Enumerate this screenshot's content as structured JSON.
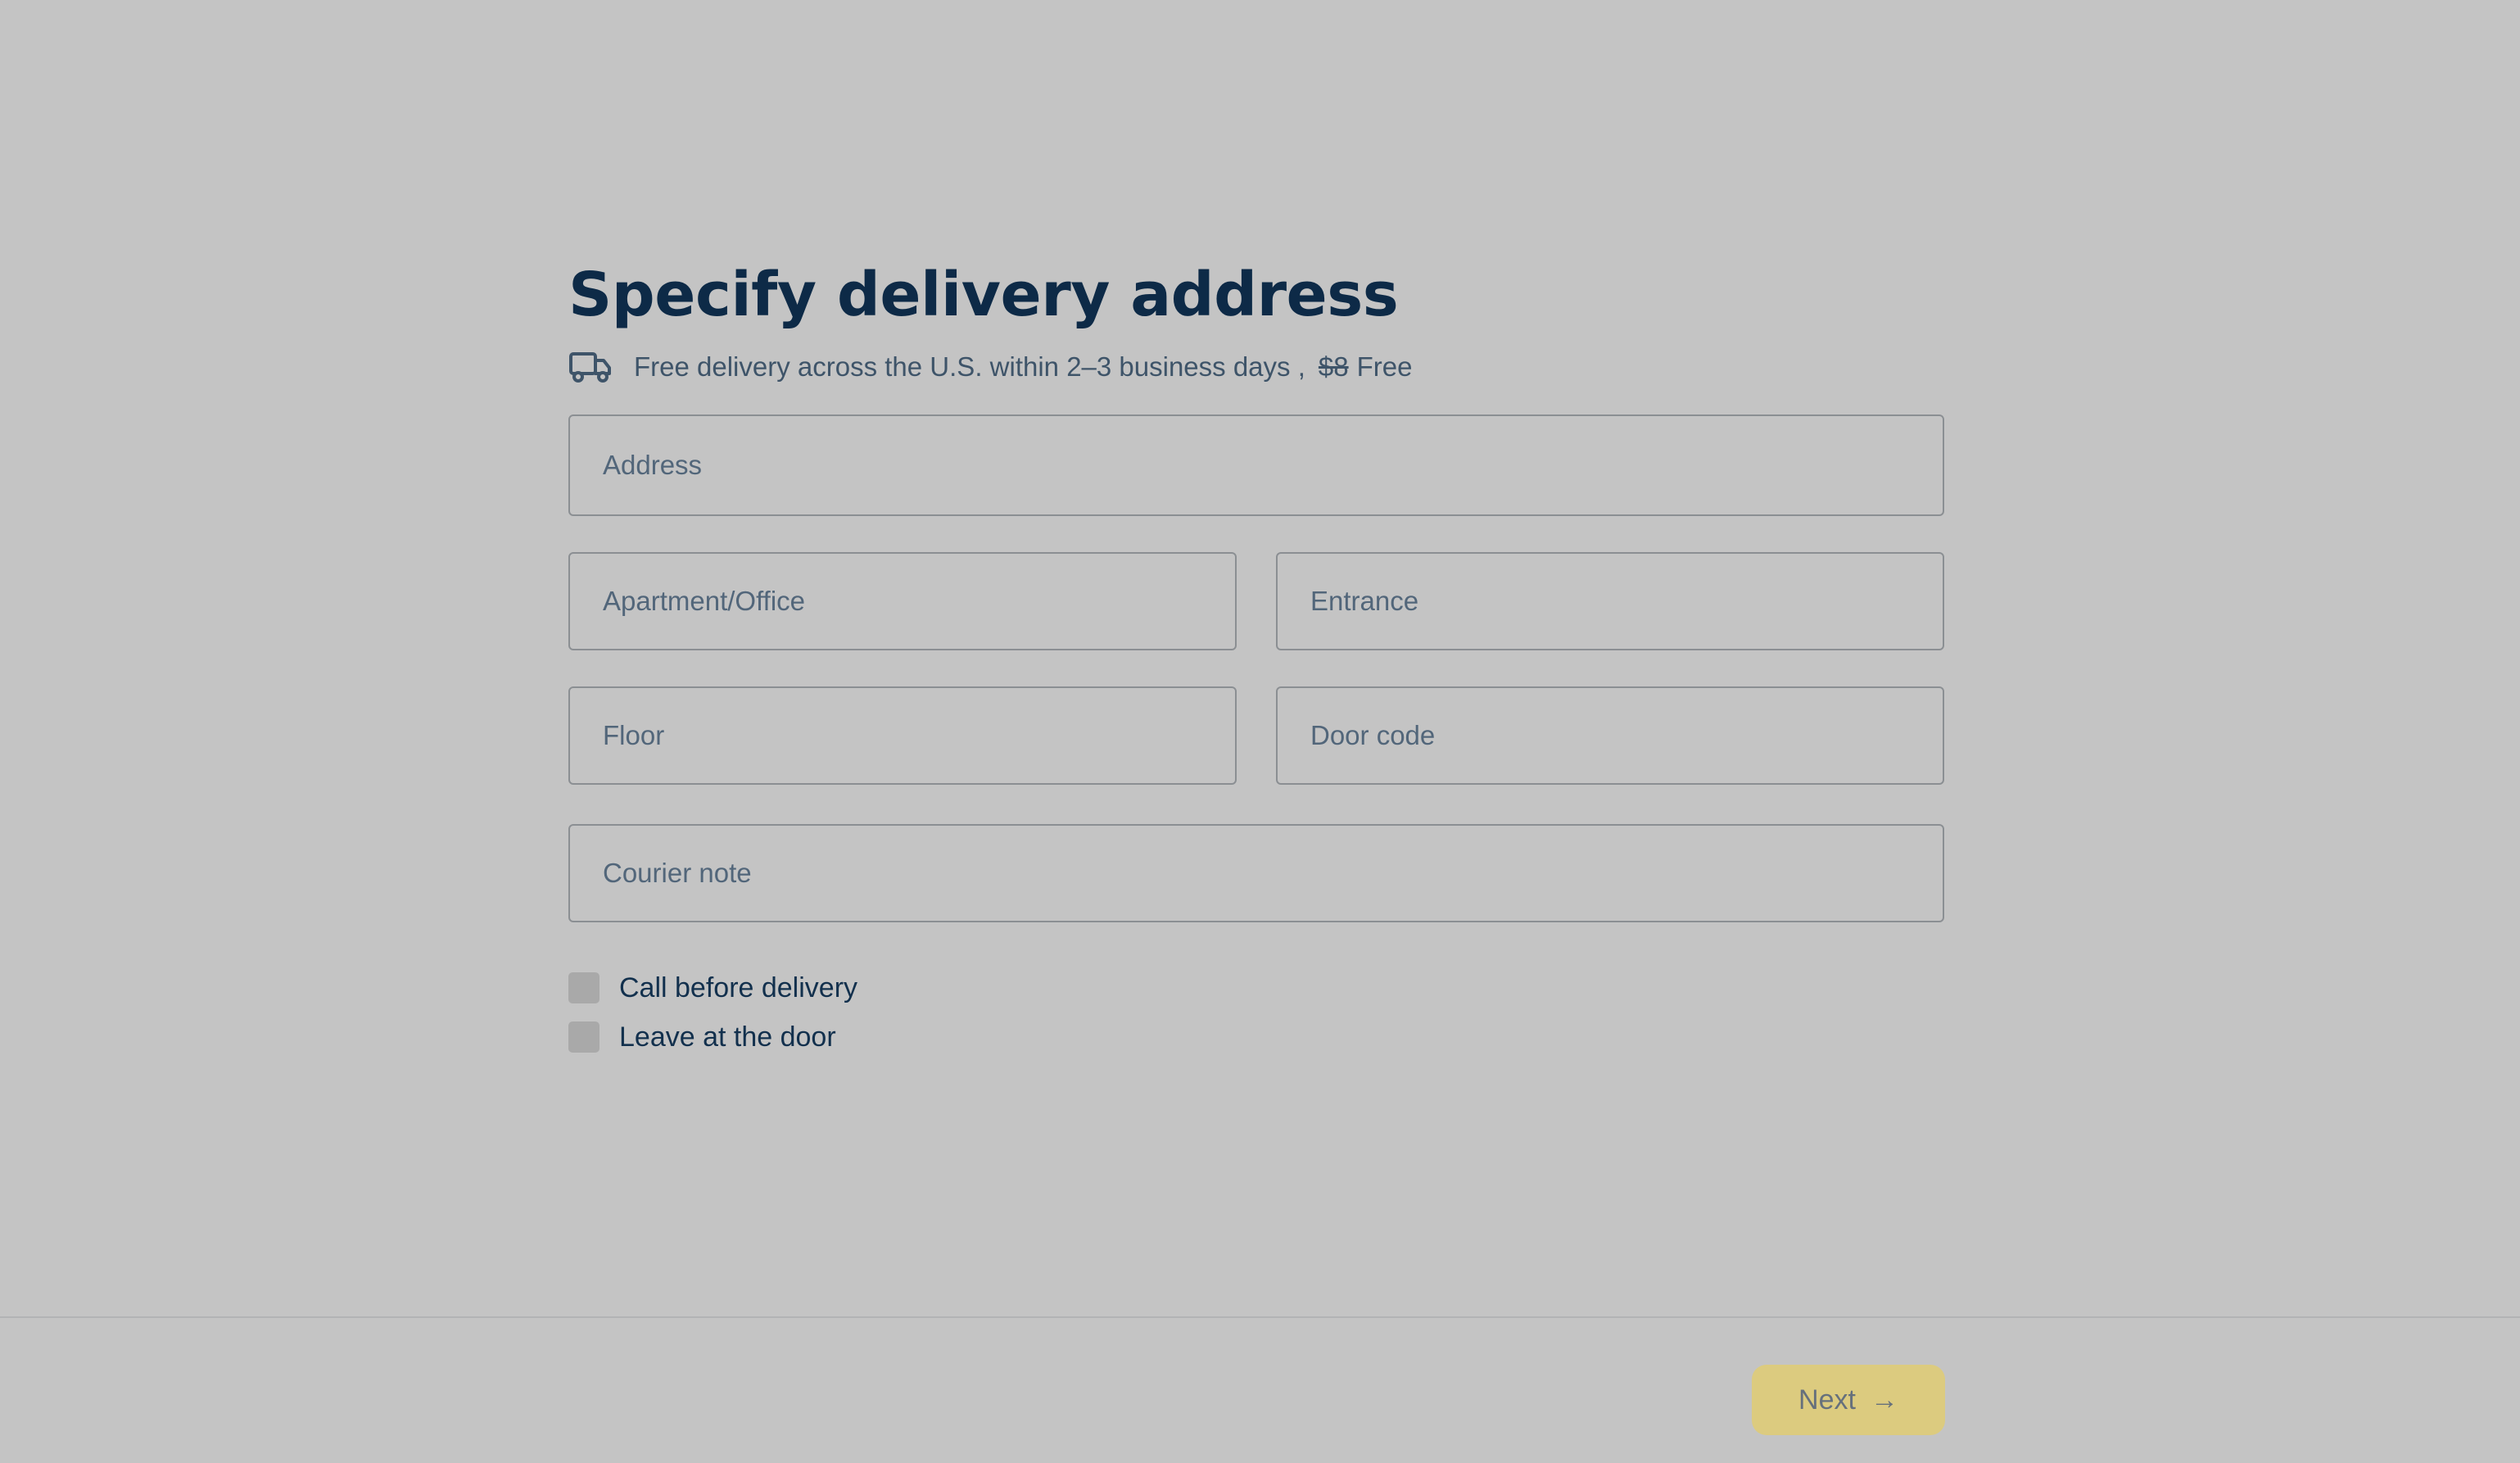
{
  "header": {
    "title": "Specify delivery address",
    "delivery_text": "Free delivery across the U.S. within 2–3 business days ,",
    "old_price": "$8",
    "new_price": "Free"
  },
  "form": {
    "address_placeholder": "Address",
    "apartment_placeholder": "Apartment/Office",
    "entrance_placeholder": "Entrance",
    "floor_placeholder": "Floor",
    "door_code_placeholder": "Door code",
    "courier_note_placeholder": "Courier note"
  },
  "options": [
    {
      "label": "Call before delivery",
      "checked": false
    },
    {
      "label": "Leave at the door",
      "checked": false
    }
  ],
  "footer": {
    "next_label": "Next"
  },
  "colors": {
    "background": "#c4c4c4",
    "title": "#0d2a47",
    "button": "#dccb7f"
  }
}
